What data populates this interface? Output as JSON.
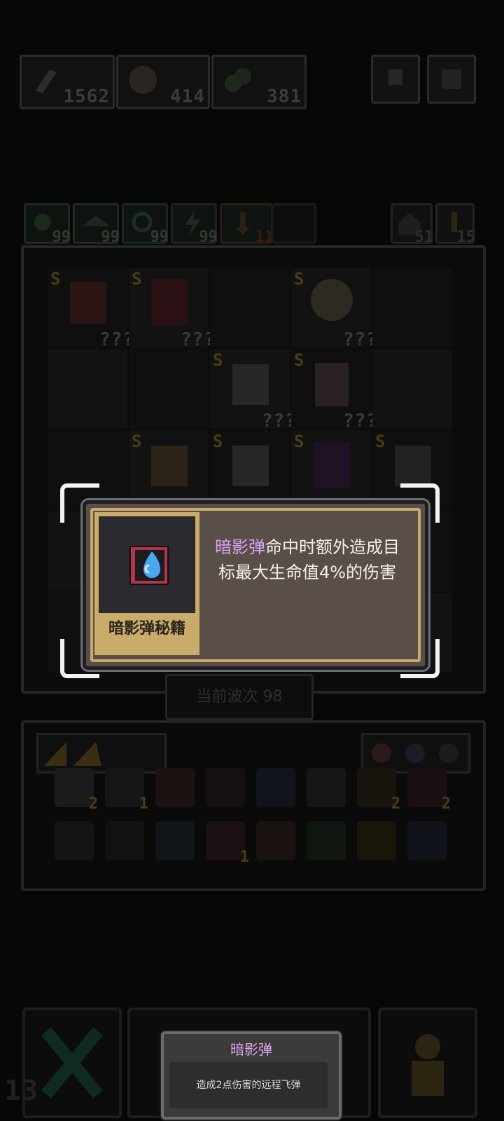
{
  "resources": [
    {
      "icon": "dagger-icon",
      "value": "1562"
    },
    {
      "icon": "boss-portrait-icon",
      "value": "414"
    },
    {
      "icon": "green-orbs-icon",
      "value": "381"
    }
  ],
  "buffs": [
    {
      "icon": "leaf-icon",
      "value": "99"
    },
    {
      "icon": "wings-icon",
      "value": "99"
    },
    {
      "icon": "swirl-icon",
      "value": "99"
    },
    {
      "icon": "lightning-icon",
      "value": "99"
    },
    {
      "icon": "sword-icon",
      "value": "11"
    }
  ],
  "side_stats": [
    {
      "icon": "house-icon",
      "value": "51"
    },
    {
      "icon": "key-icon",
      "value": "15"
    }
  ],
  "board": {
    "rank_label": "S",
    "unknown_label": "???"
  },
  "wave_label": "当前波次 98",
  "inventory_counts": [
    "2",
    "1",
    "2",
    "2",
    "1"
  ],
  "skill_popup": {
    "item_name": "暗影弹秘籍",
    "desc_highlight": "暗影弹",
    "desc_rest": "命中时额外造成目标最大生命值4%的伤害"
  },
  "bottom_counter": "13",
  "toast": {
    "title": "暗影弹",
    "body": "造成2点伤害的远程飞弹"
  },
  "colors": {
    "highlight_purple": "#d7a3f4",
    "gold": "#c9ac6a",
    "popup_bg": "#5a4f48"
  }
}
